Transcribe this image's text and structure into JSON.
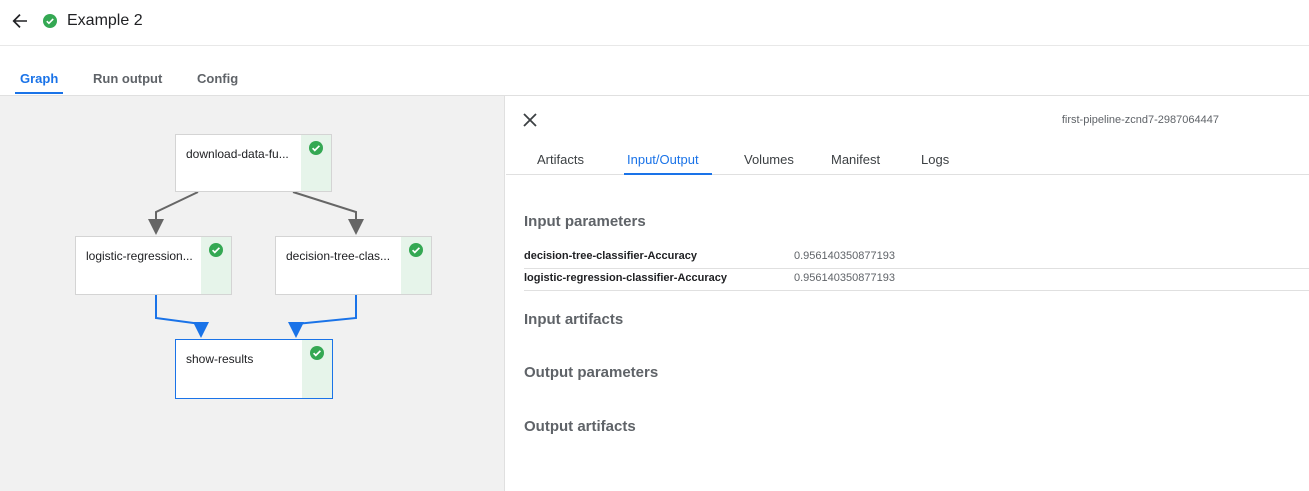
{
  "header": {
    "run_title": "Example 2",
    "status": "succeeded",
    "icons": {
      "back": "arrow-back-icon",
      "status": "check-circle-icon"
    }
  },
  "tabs": [
    "Graph",
    "Run output",
    "Config"
  ],
  "active_tab": "Graph",
  "graph": {
    "nodes": [
      {
        "label": "download-data-fu...",
        "status": "succeeded"
      },
      {
        "label": "logistic-regression...",
        "status": "succeeded"
      },
      {
        "label": "decision-tree-clas...",
        "status": "succeeded"
      },
      {
        "label": "show-results",
        "status": "succeeded",
        "selected": true
      }
    ],
    "colors": {
      "edge": "#666666",
      "selected_edge": "#1a73e8",
      "success": "#34a853"
    }
  },
  "details": {
    "pod_id": "first-pipeline-zcnd7-2987064447",
    "tabs": [
      "Artifacts",
      "Input/Output",
      "Volumes",
      "Manifest",
      "Logs"
    ],
    "active_tab": "Input/Output",
    "input_parameters_title": "Input parameters",
    "input_parameters": [
      {
        "name": "decision-tree-classifier-Accuracy",
        "value": "0.956140350877193"
      },
      {
        "name": "logistic-regression-classifier-Accuracy",
        "value": "0.956140350877193"
      }
    ],
    "input_artifacts_title": "Input artifacts",
    "output_parameters_title": "Output parameters",
    "output_artifacts_title": "Output artifacts",
    "icons": {
      "close": "close-icon"
    }
  },
  "colors": {
    "accent": "#1a73e8",
    "success": "#34a853"
  }
}
